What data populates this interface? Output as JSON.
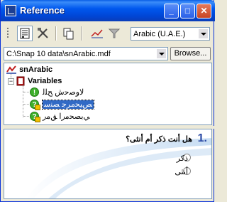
{
  "window": {
    "title": "Reference"
  },
  "toolbar": {
    "language_combo": "Arabic (U.A.E.)"
  },
  "path": {
    "value": "C:\\Snap 10 data\\snArabic.mdf",
    "browse_label": "Browse..."
  },
  "tree": {
    "root_label": "snArabic",
    "variables_label": "Variables",
    "items": [
      {
        "label": "ﻻوﺻﺣش ﺢﻠﻟ",
        "selected": false
      },
      {
        "label": "ﺺﻴﺤﻣﺮﺟ ﺼﻨﺳ",
        "selected": true
      },
      {
        "label": "ﻲﺑﺼﺤﻣرا ﻖﻣر",
        "selected": false
      }
    ]
  },
  "question": {
    "number": "1.",
    "text": "هل أنت ذكر أم أنثى؟",
    "options": [
      "ذكر",
      "أنثى"
    ]
  }
}
